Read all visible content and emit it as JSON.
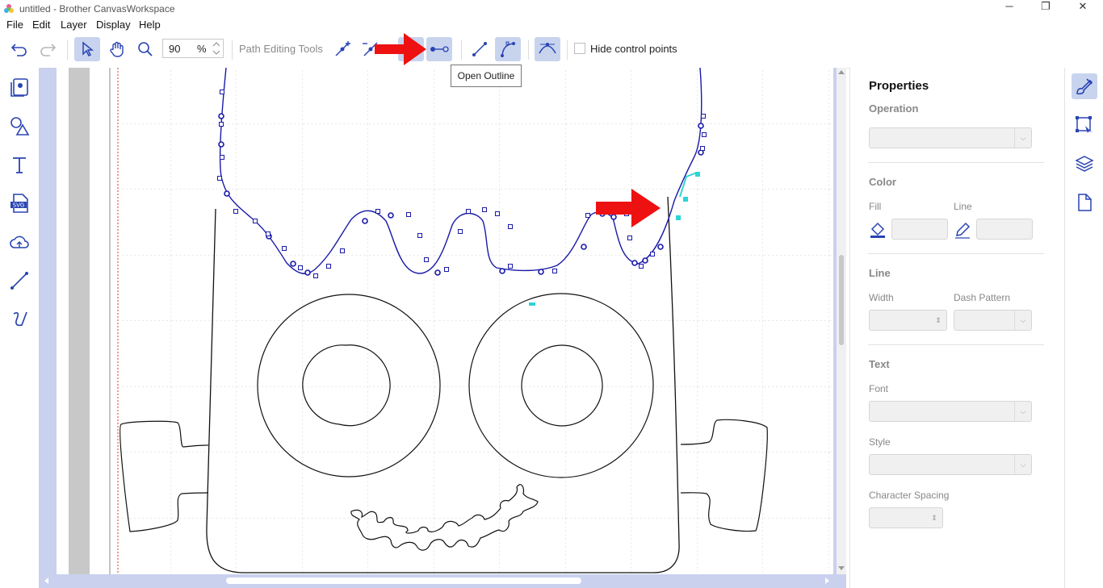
{
  "window": {
    "title": "untitled - Brother CanvasWorkspace",
    "minimize_glyph": "─",
    "restore_glyph": "❐",
    "close_glyph": "✕"
  },
  "menu": [
    "File",
    "Edit",
    "Layer",
    "Display",
    "Help"
  ],
  "toolbar": {
    "zoom_value": "90",
    "zoom_unit": "%",
    "path_editing_label": "Path Editing Tools",
    "hide_control_points_label": "Hide control points",
    "hide_control_points_checked": false,
    "tooltip": "Open Outline",
    "icons": [
      "undo-icon",
      "redo-icon",
      "select-arrow-icon",
      "hand-pan-icon",
      "zoom-magnifier-icon",
      "add-node-icon",
      "delete-node-icon",
      "join-node-icon",
      "open-outline-icon",
      "straight-line-icon",
      "curve-icon",
      "smooth-node-icon"
    ]
  },
  "left_tools": [
    "pattern-library-icon",
    "shapes-icon",
    "text-icon",
    "svg-import-icon",
    "cloud-icon",
    "line-draw-icon",
    "freehand-icon"
  ],
  "right_tools": [
    "properties-brush-icon",
    "transform-icon",
    "layers-icon",
    "page-icon"
  ],
  "properties": {
    "title": "Properties",
    "operation_label": "Operation",
    "color_section": "Color",
    "fill_label": "Fill",
    "line_label": "Line",
    "line_section": "Line",
    "width_label": "Width",
    "dash_label": "Dash Pattern",
    "text_section": "Text",
    "font_label": "Font",
    "style_label": "Style",
    "spacing_label": "Character Spacing"
  },
  "colors": {
    "accent": "#c8d4ee",
    "canvas_bg": "#c9d1ee",
    "path_selected": "#1a1aa8",
    "annotation_arrow": "#ee1111",
    "highlight_segment": "#2fd4d4"
  }
}
